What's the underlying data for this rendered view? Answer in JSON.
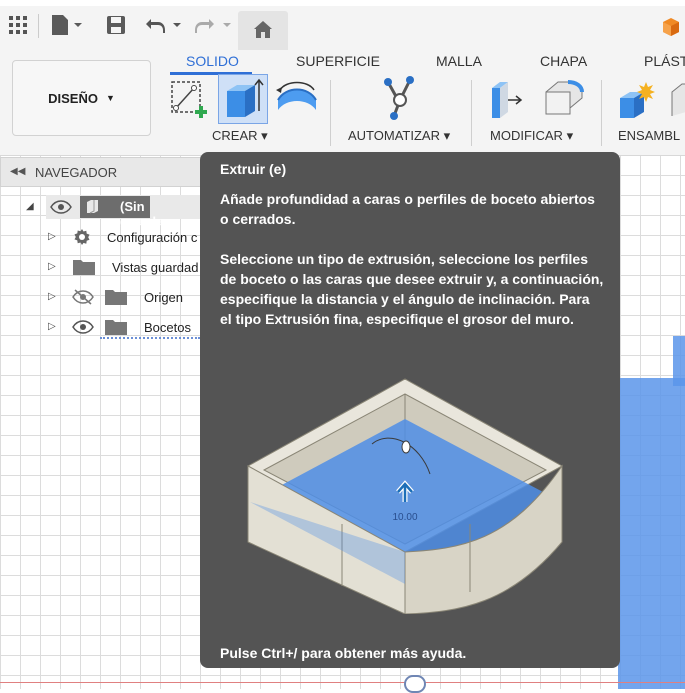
{
  "topbar": {
    "icons": [
      "grid-icon",
      "file-icon",
      "save-icon",
      "undo-icon",
      "redo-icon",
      "home-icon",
      "app-cube-icon"
    ]
  },
  "ribbon": {
    "workspace": "DISEÑO",
    "tabs": [
      "SOLIDO",
      "SUPERFICIE",
      "MALLA",
      "CHAPA",
      "PLÁST"
    ],
    "active_tab": "SOLIDO",
    "groups": {
      "crear": "CREAR",
      "automatizar": "AUTOMATIZAR",
      "modificar": "MODIFICAR",
      "ensamblar": "ENSAMBL"
    },
    "accent": "#2f6fd6"
  },
  "browser": {
    "title": "NAVEGADOR",
    "root": "(Sin guardar",
    "items": [
      {
        "label": "Configuración c",
        "icon": "gear-icon"
      },
      {
        "label": "Vistas guardad",
        "icon": "folder-icon"
      },
      {
        "label": "Origen",
        "icon": "folder-icon"
      },
      {
        "label": "Bocetos",
        "icon": "folder-icon"
      }
    ]
  },
  "tooltip": {
    "title": "Extruir (e)",
    "para1": "Añade profundidad a caras o perfiles de boceto abiertos o cerrados.",
    "para2": "Seleccione un tipo de extrusión, seleccione los perfiles de boceto o las caras que desee extruir y, a continuación, especifique la distancia y el ángulo de inclinación. Para el tipo Extrusión fina, especifique el grosor del muro.",
    "illustration_value": "10.00",
    "footer": "Pulse Ctrl+/ para obtener más ayuda.",
    "bg_color": "#545454"
  }
}
